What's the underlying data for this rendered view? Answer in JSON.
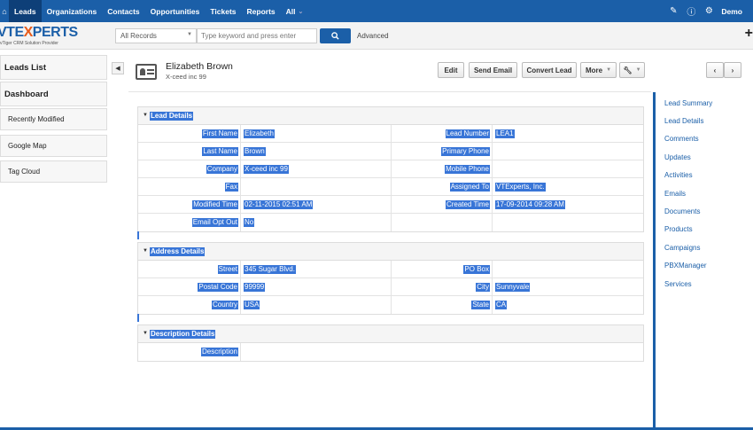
{
  "topnav": {
    "items": [
      "Leads",
      "Organizations",
      "Contacts",
      "Opportunities",
      "Tickets",
      "Reports",
      "All"
    ],
    "all_caret": "⌄",
    "user": "Demo",
    "home_icon": "home-icon",
    "pencil_icon": "pencil-icon",
    "info_icon": "info-icon",
    "gear_icon": "gear-icon"
  },
  "logo": {
    "brand_a": "VTE",
    "brand_x": "X",
    "brand_b": "PERTS",
    "tag": "vTiger CRM Solution Provider"
  },
  "search": {
    "records_select": "All Records",
    "keyword_placeholder": "Type keyword and press enter",
    "advanced": "Advanced"
  },
  "sidebar": {
    "items": [
      "Leads List",
      "Dashboard",
      "Recently Modified",
      "Google Map",
      "Tag Cloud"
    ]
  },
  "record": {
    "name": "Elizabeth Brown",
    "sub": "X-ceed inc 99"
  },
  "actions": {
    "edit": "Edit",
    "send_email": "Send Email",
    "convert_lead": "Convert Lead",
    "more": "More"
  },
  "lead_details": {
    "title": "Lead Details",
    "rows": [
      {
        "l1": "First Name",
        "v1": "Elizabeth",
        "l2": "Lead Number",
        "v2": "LEA1"
      },
      {
        "l1": "Last Name",
        "v1": "Brown",
        "l2": "Primary Phone",
        "v2": ""
      },
      {
        "l1": "Company",
        "v1": "X-ceed inc 99",
        "l2": "Mobile Phone",
        "v2": ""
      },
      {
        "l1": "Fax",
        "v1": "",
        "l2": "Assigned To",
        "v2": "VTExperts, Inc."
      },
      {
        "l1": "Modified Time",
        "v1": "02-11-2015 02:51 AM",
        "l2": "Created Time",
        "v2": "17-09-2014 09:28 AM"
      },
      {
        "l1": "Email Opt Out",
        "v1": "No",
        "l2": "",
        "v2": ""
      }
    ]
  },
  "address_details": {
    "title": "Address Details",
    "rows": [
      {
        "l1": "Street",
        "v1": "345 Sugar Blvd.",
        "l2": "PO Box",
        "v2": ""
      },
      {
        "l1": "Postal Code",
        "v1": "99999",
        "l2": "City",
        "v2": "Sunnyvale"
      },
      {
        "l1": "Country",
        "v1": "USA",
        "l2": "State",
        "v2": "CA"
      }
    ]
  },
  "description_details": {
    "title": "Description Details",
    "label": "Description",
    "value": ""
  },
  "right_panel": {
    "items": [
      "Lead Summary",
      "Lead Details",
      "Comments",
      "Updates",
      "Activities",
      "Emails",
      "Documents",
      "Products",
      "Campaigns",
      "PBXManager",
      "Services"
    ]
  },
  "colors": {
    "nav_bg": "#1b5fa8",
    "selection": "#3875d7",
    "logo_x": "#e85b1a"
  }
}
